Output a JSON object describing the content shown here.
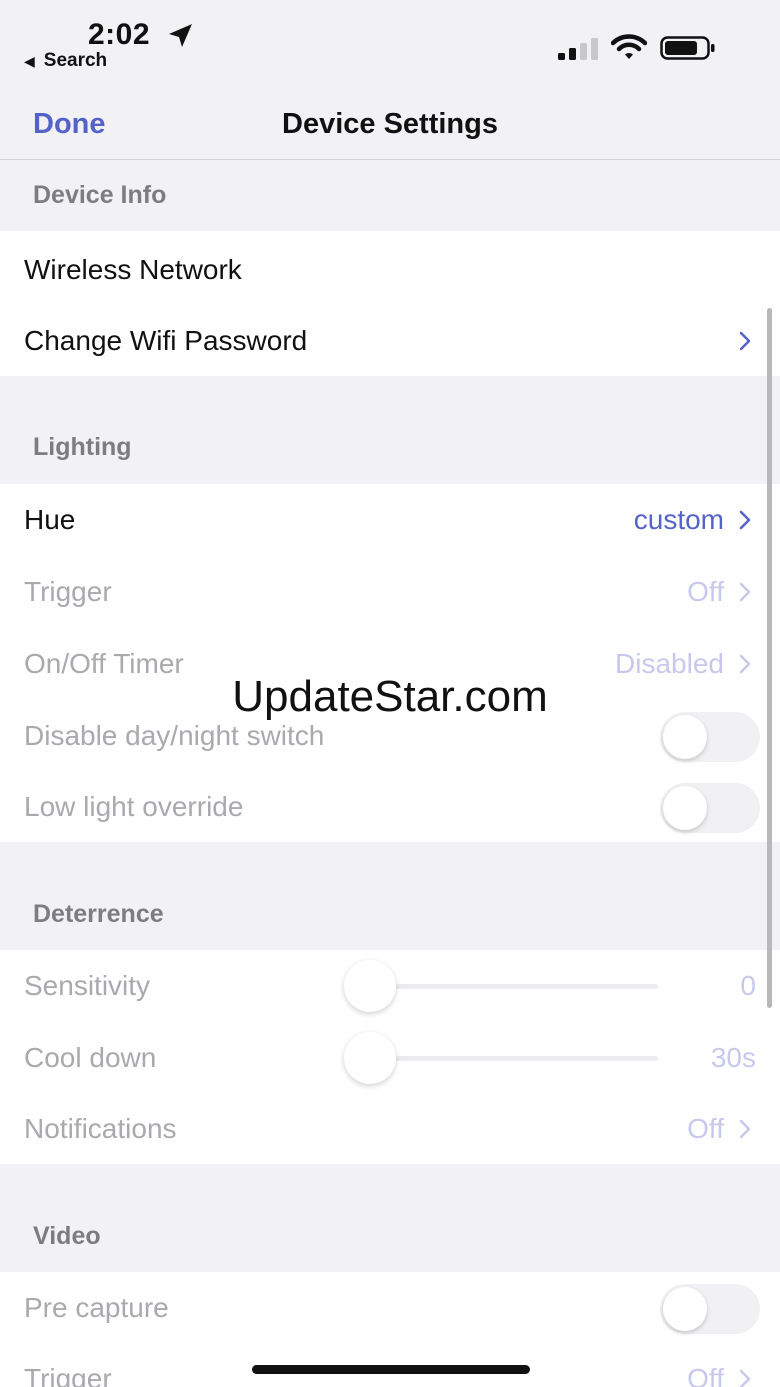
{
  "status_bar": {
    "time": "2:02",
    "back_app_label": "Search",
    "icons": [
      "location-arrow-icon",
      "cellular-signal-icon",
      "wifi-icon",
      "battery-icon"
    ]
  },
  "nav": {
    "done_label": "Done",
    "title": "Device Settings"
  },
  "sections": {
    "device_info": {
      "header": "Device Info",
      "rows": {
        "wireless_network": {
          "label": "Wireless Network"
        },
        "change_wifi_password": {
          "label": "Change Wifi Password"
        }
      }
    },
    "lighting": {
      "header": "Lighting",
      "rows": {
        "hue": {
          "label": "Hue",
          "value": "custom"
        },
        "trigger": {
          "label": "Trigger",
          "value": "Off"
        },
        "on_off_timer": {
          "label": "On/Off Timer",
          "value": "Disabled"
        },
        "disable_day_night_switch": {
          "label": "Disable day/night switch",
          "on": false
        },
        "low_light_override": {
          "label": "Low light override",
          "on": false
        }
      }
    },
    "deterrence": {
      "header": "Deterrence",
      "rows": {
        "sensitivity": {
          "label": "Sensitivity",
          "value": "0"
        },
        "cool_down": {
          "label": "Cool down",
          "value": "30s"
        },
        "notifications": {
          "label": "Notifications",
          "value": "Off"
        }
      }
    },
    "video": {
      "header": "Video",
      "rows": {
        "pre_capture": {
          "label": "Pre capture",
          "on": false
        },
        "trigger": {
          "label": "Trigger",
          "value": "Off"
        }
      }
    }
  },
  "watermark": "UpdateStar.com",
  "colors": {
    "accent": "#5563c8",
    "accent_dim": "#c7c9ec",
    "label_dim": "#a9a9ae",
    "section_header_text": "#7c7c82",
    "background": "#f2f2f4"
  }
}
